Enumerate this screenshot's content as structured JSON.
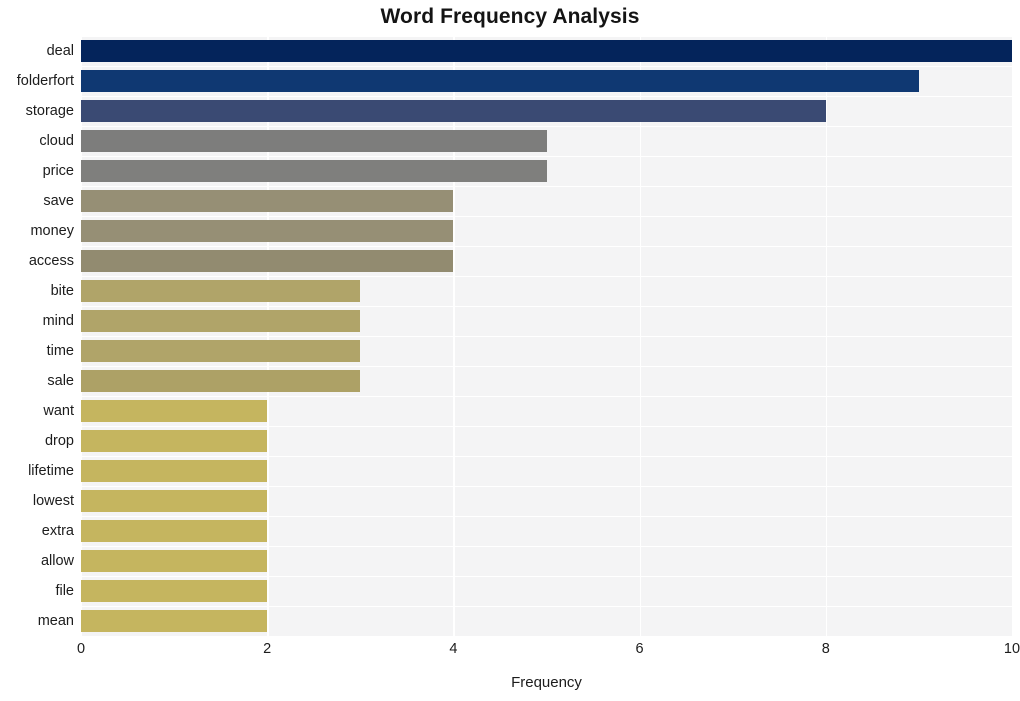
{
  "chart_data": {
    "type": "bar",
    "orientation": "horizontal",
    "title": "Word Frequency Analysis",
    "xlabel": "Frequency",
    "ylabel": "",
    "categories": [
      "deal",
      "folderfort",
      "storage",
      "cloud",
      "price",
      "save",
      "money",
      "access",
      "bite",
      "mind",
      "time",
      "sale",
      "want",
      "drop",
      "lifetime",
      "lowest",
      "extra",
      "allow",
      "file",
      "mean"
    ],
    "values": [
      10,
      9,
      8,
      5,
      5,
      4,
      4,
      4,
      3,
      3,
      3,
      3,
      2,
      2,
      2,
      2,
      2,
      2,
      2,
      2
    ],
    "bar_colors": [
      "#04245b",
      "#0f3872",
      "#3a4a73",
      "#7d7d7c",
      "#7f7f7d",
      "#968f75",
      "#968f75",
      "#928b70",
      "#b0a469",
      "#b0a469",
      "#b0a469",
      "#ada166",
      "#c5b55f",
      "#c5b55f",
      "#c5b55f",
      "#c5b55f",
      "#c5b55f",
      "#c5b55f",
      "#c5b55f",
      "#c5b55f"
    ],
    "xlim": [
      0,
      10
    ],
    "xticks": [
      0,
      2,
      4,
      6,
      8,
      10
    ],
    "xtick_labels": [
      "0",
      "2",
      "4",
      "6",
      "8",
      "10"
    ],
    "grid": true,
    "grid_color": "#ffffff",
    "plot_background": "#f4f4f5",
    "figure_background": "#ffffff",
    "legend": null
  }
}
